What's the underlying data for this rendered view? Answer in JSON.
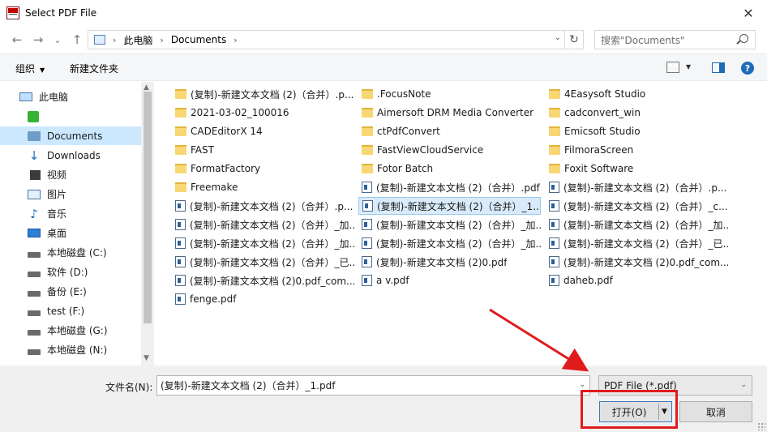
{
  "window": {
    "title": "Select PDF File",
    "close_glyph": "✕"
  },
  "nav": {
    "back": "←",
    "forward": "→",
    "recent": "⌄",
    "up": "↑",
    "breadcrumbs": [
      "此电脑",
      "Documents"
    ],
    "refresh": "↻",
    "search_placeholder": "搜索\"Documents\""
  },
  "toolbar": {
    "organize": "组织",
    "new_folder": "新建文件夹",
    "help": "?"
  },
  "sidebar": {
    "items": [
      {
        "label": "此电脑",
        "icon": "computer-icon"
      },
      {
        "label": "",
        "icon": "app-green-icon"
      },
      {
        "label": "Documents",
        "icon": "documents-icon"
      },
      {
        "label": "Downloads",
        "icon": "downloads-icon"
      },
      {
        "label": "视频",
        "icon": "video-icon"
      },
      {
        "label": "图片",
        "icon": "pictures-icon"
      },
      {
        "label": "音乐",
        "icon": "music-icon"
      },
      {
        "label": "桌面",
        "icon": "desktop-icon"
      },
      {
        "label": "本地磁盘 (C:)",
        "icon": "drive-icon"
      },
      {
        "label": "软件 (D:)",
        "icon": "drive-icon"
      },
      {
        "label": "备份 (E:)",
        "icon": "drive-icon"
      },
      {
        "label": "test (F:)",
        "icon": "drive-icon"
      },
      {
        "label": "本地磁盘 (G:)",
        "icon": "drive-icon"
      },
      {
        "label": "本地磁盘 (N:)",
        "icon": "drive-icon"
      }
    ],
    "selected_index": 2
  },
  "files": {
    "col1": [
      {
        "name": "(复制)-新建文本文档 (2)（合并）.p...",
        "type": "folder"
      },
      {
        "name": "2021-03-02_100016",
        "type": "folder"
      },
      {
        "name": "CADEditorX 14",
        "type": "folder"
      },
      {
        "name": "FAST",
        "type": "folder"
      },
      {
        "name": "FormatFactory",
        "type": "folder"
      },
      {
        "name": "Freemake",
        "type": "folder"
      },
      {
        "name": "(复制)-新建文本文档 (2)（合并）.p...",
        "type": "pdf"
      },
      {
        "name": "(复制)-新建文本文档 (2)（合并）_加...",
        "type": "pdf"
      },
      {
        "name": "(复制)-新建文本文档 (2)（合并）_加...",
        "type": "pdf"
      },
      {
        "name": "(复制)-新建文本文档 (2)（合并）_已...",
        "type": "pdf"
      },
      {
        "name": "(复制)-新建文本文档 (2)0.pdf_com...",
        "type": "pdf"
      },
      {
        "name": "fenge.pdf",
        "type": "pdf"
      }
    ],
    "col2": [
      {
        "name": ".FocusNote",
        "type": "folder"
      },
      {
        "name": "Aimersoft DRM Media Converter",
        "type": "folder"
      },
      {
        "name": "ctPdfConvert",
        "type": "folder"
      },
      {
        "name": "FastViewCloudService",
        "type": "folder"
      },
      {
        "name": "Fotor Batch",
        "type": "folder"
      },
      {
        "name": "(复制)-新建文本文档 (2)（合并）.pdf",
        "type": "pdf"
      },
      {
        "name": "(复制)-新建文本文档 (2)（合并）_1....",
        "type": "pdf",
        "selected": true
      },
      {
        "name": "(复制)-新建文本文档 (2)（合并）_加...",
        "type": "pdf"
      },
      {
        "name": "(复制)-新建文本文档 (2)（合并）_加...",
        "type": "pdf"
      },
      {
        "name": "(复制)-新建文本文档 (2)0.pdf",
        "type": "pdf"
      },
      {
        "name": "a v.pdf",
        "type": "pdf"
      }
    ],
    "col3": [
      {
        "name": "4Easysoft Studio",
        "type": "folder"
      },
      {
        "name": "cadconvert_win",
        "type": "folder"
      },
      {
        "name": "Emicsoft Studio",
        "type": "folder"
      },
      {
        "name": "FilmoraScreen",
        "type": "folder"
      },
      {
        "name": "Foxit Software",
        "type": "folder"
      },
      {
        "name": "(复制)-新建文本文档 (2)（合并）.p...",
        "type": "pdf"
      },
      {
        "name": "(复制)-新建文本文档 (2)（合并）_c...",
        "type": "pdf"
      },
      {
        "name": "(复制)-新建文本文档 (2)（合并）_加...",
        "type": "pdf"
      },
      {
        "name": "(复制)-新建文本文档 (2)（合并）_已...",
        "type": "pdf"
      },
      {
        "name": "(复制)-新建文本文档 (2)0.pdf_com...",
        "type": "pdf"
      },
      {
        "name": "daheb.pdf",
        "type": "pdf"
      }
    ]
  },
  "bottom": {
    "filename_label": "文件名(N):",
    "filename_value": "(复制)-新建文本文档 (2)（合并）_1.pdf",
    "filetype": "PDF File (*.pdf)",
    "open": "打开(O)",
    "cancel": "取消"
  },
  "colors": {
    "highlight": "#e01b1b",
    "selection": "#cce8ff",
    "accent": "#1e6bb8"
  }
}
